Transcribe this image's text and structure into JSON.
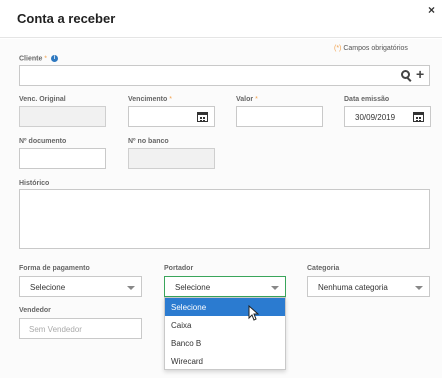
{
  "modal": {
    "title": "Conta a receber",
    "close_symbol": "×",
    "required_note_star": "(*)",
    "required_note": "Campos obrigatórios"
  },
  "fields": {
    "cliente": {
      "label": "Cliente",
      "required_mark": "*",
      "info_symbol": "i",
      "value": ""
    },
    "venc_original": {
      "label": "Venc. Original",
      "value": ""
    },
    "vencimento": {
      "label": "Vencimento",
      "required_mark": "*",
      "value": ""
    },
    "valor": {
      "label": "Valor",
      "required_mark": "*",
      "value": ""
    },
    "data_emissao": {
      "label": "Data emissão",
      "value": "30/09/2019"
    },
    "n_documento": {
      "label": "Nº documento",
      "value": ""
    },
    "n_banco": {
      "label": "Nº no banco",
      "value": ""
    },
    "historico": {
      "label": "Histórico",
      "value": ""
    },
    "forma_pagamento": {
      "label": "Forma de pagamento",
      "value": "Selecione"
    },
    "portador": {
      "label": "Portador",
      "value": "Selecione"
    },
    "categoria": {
      "label": "Categoria",
      "value": "Nenhuma categoria"
    },
    "vendedor": {
      "label": "Vendedor",
      "placeholder": "Sem Vendedor"
    }
  },
  "portador_dropdown": {
    "options": [
      "Selecione",
      "Caixa",
      "Banco B",
      "Wirecard"
    ],
    "highlighted_index": 0
  },
  "icons": {
    "search": "search-icon",
    "plus": "plus-icon",
    "calendar": "calendar-icon",
    "info": "info-icon",
    "caret": "chevron-down-icon",
    "cursor": "mouse-pointer-icon"
  },
  "colors": {
    "required_star": "#f2a24e",
    "info_badge": "#2e78c0",
    "active_select_border": "#3aa55b",
    "selected_option_bg": "#2b7bd0"
  }
}
